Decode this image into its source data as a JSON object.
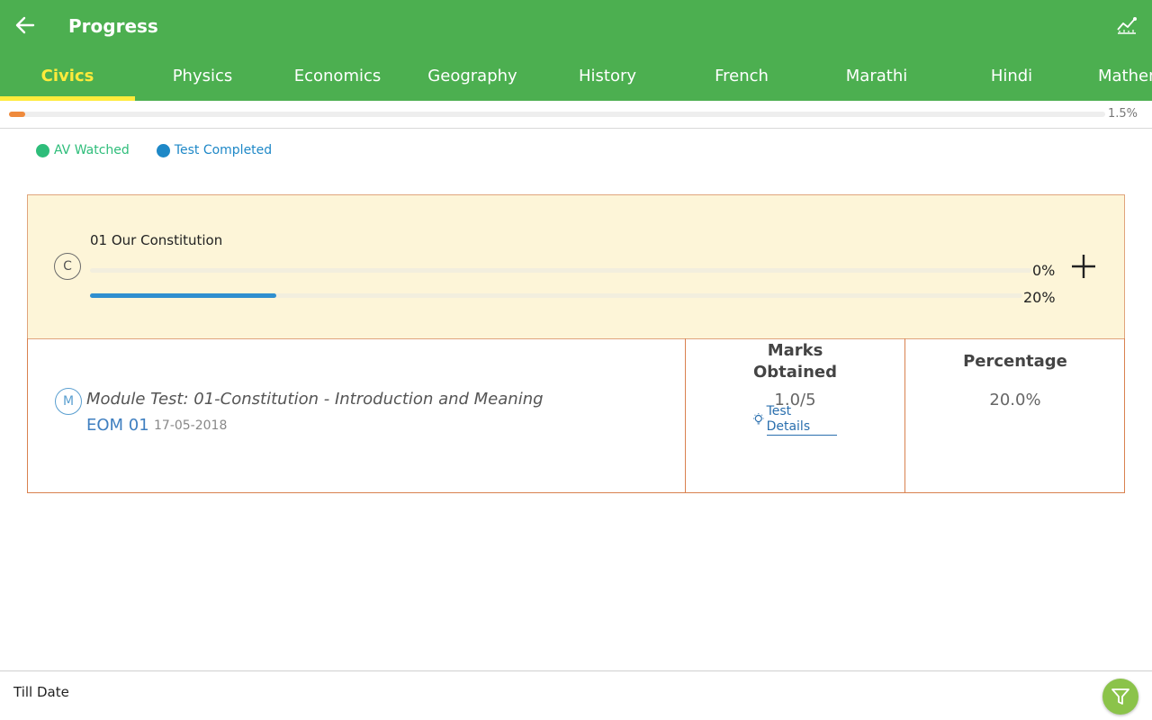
{
  "appbar": {
    "title": "Progress",
    "back_icon": "arrow-left-icon",
    "trend_icon": "trend-chart-icon"
  },
  "tabs": [
    {
      "label": "Civics",
      "active": true
    },
    {
      "label": "Physics",
      "active": false
    },
    {
      "label": "Economics",
      "active": false
    },
    {
      "label": "Geography",
      "active": false
    },
    {
      "label": "History",
      "active": false
    },
    {
      "label": "French",
      "active": false
    },
    {
      "label": "Marathi",
      "active": false
    },
    {
      "label": "Hindi",
      "active": false
    },
    {
      "label": "Mathematics",
      "active": false
    }
  ],
  "overall_progress": {
    "label": "1.5%",
    "value": 1.5,
    "color": "#ef8a3c"
  },
  "legend": [
    {
      "label": "AV Watched",
      "color": "#2ebd7a"
    },
    {
      "label": "Test Completed",
      "color": "#1e88c7"
    }
  ],
  "chapter": {
    "badge": "C",
    "title": "01 Our Constitution",
    "av_watched": {
      "label": "0%",
      "value": 0,
      "color": "#2ebd7a"
    },
    "test_completed": {
      "label": "20%",
      "value": 20,
      "color": "#2f8fcf"
    },
    "expand_icon": "plus-icon"
  },
  "test": {
    "badge": "M",
    "title": "Module Test: 01-Constitution - Introduction and Meaning",
    "code": "EOM 01",
    "date": "17-05-2018",
    "marks_header_line1": "Marks",
    "marks_header_line2": "Obtained",
    "marks_value": "1.0/5",
    "details_icon": "lightbulb-icon",
    "details_label": "Test Details",
    "percentage_header": "Percentage",
    "percentage_value": "20.0%"
  },
  "footer": {
    "label": "Till Date",
    "filter_icon": "filter-icon",
    "filter_color": "#8bc34a"
  }
}
